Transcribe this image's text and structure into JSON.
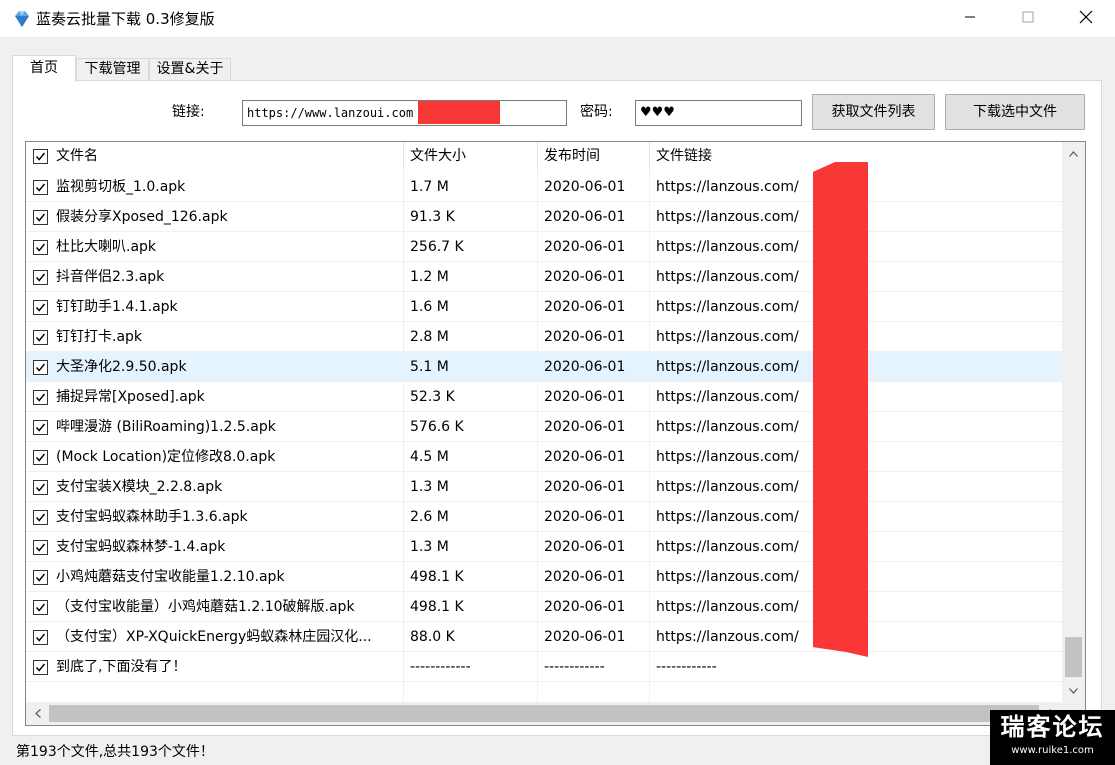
{
  "window": {
    "title": "蓝奏云批量下载 0.3修复版",
    "icon": "diamond-icon",
    "controls": [
      "minimize-icon",
      "maximize-icon",
      "close-icon"
    ]
  },
  "tabs": [
    {
      "label": "首页",
      "active": true
    },
    {
      "label": "下载管理",
      "active": false
    },
    {
      "label": "设置&关于",
      "active": false
    }
  ],
  "form": {
    "link_label": "链接:",
    "link_value": "https://www.lanzoui.com",
    "password_label": "密码:",
    "password_value": "♥♥♥",
    "fetch_button": "获取文件列表",
    "download_button": "下载选中文件"
  },
  "table": {
    "headers": {
      "name": "文件名",
      "size": "文件大小",
      "date": "发布时间",
      "link": "文件链接"
    },
    "rows": [
      {
        "name": "监视剪切板_1.0.apk",
        "size": "1.7 M",
        "date": "2020-06-01",
        "link": "https://lanzous.com/",
        "checked": true
      },
      {
        "name": "假装分享Xposed_126.apk",
        "size": "91.3 K",
        "date": "2020-06-01",
        "link": "https://lanzous.com/",
        "checked": true
      },
      {
        "name": "杜比大喇叭.apk",
        "size": "256.7 K",
        "date": "2020-06-01",
        "link": "https://lanzous.com/",
        "checked": true
      },
      {
        "name": "抖音伴侣2.3.apk",
        "size": "1.2 M",
        "date": "2020-06-01",
        "link": "https://lanzous.com/",
        "checked": true
      },
      {
        "name": "钉钉助手1.4.1.apk",
        "size": "1.6 M",
        "date": "2020-06-01",
        "link": "https://lanzous.com/",
        "checked": true
      },
      {
        "name": "钉钉打卡.apk",
        "size": "2.8 M",
        "date": "2020-06-01",
        "link": "https://lanzous.com/",
        "checked": true
      },
      {
        "name": "大圣净化2.9.50.apk",
        "size": "5.1 M",
        "date": "2020-06-01",
        "link": "https://lanzous.com/",
        "checked": true,
        "selected": true
      },
      {
        "name": "捕捉异常[Xposed].apk",
        "size": "52.3 K",
        "date": "2020-06-01",
        "link": "https://lanzous.com/",
        "checked": true
      },
      {
        "name": "哔哩漫游 (BiliRoaming)1.2.5.apk",
        "size": "576.6 K",
        "date": "2020-06-01",
        "link": "https://lanzous.com/",
        "checked": true
      },
      {
        "name": "(Mock Location)定位修改8.0.apk",
        "size": "4.5 M",
        "date": "2020-06-01",
        "link": "https://lanzous.com/",
        "checked": true
      },
      {
        "name": "支付宝装X模块_2.2.8.apk",
        "size": "1.3 M",
        "date": "2020-06-01",
        "link": "https://lanzous.com/",
        "checked": true
      },
      {
        "name": "支付宝蚂蚁森林助手1.3.6.apk",
        "size": "2.6 M",
        "date": "2020-06-01",
        "link": "https://lanzous.com/",
        "checked": true
      },
      {
        "name": "支付宝蚂蚁森林梦-1.4.apk",
        "size": "1.3 M",
        "date": "2020-06-01",
        "link": "https://lanzous.com/",
        "checked": true
      },
      {
        "name": "小鸡炖蘑菇支付宝收能量1.2.10.apk",
        "size": "498.1 K",
        "date": "2020-06-01",
        "link": "https://lanzous.com/",
        "checked": true
      },
      {
        "name": "（支付宝收能量）小鸡炖蘑菇1.2.10破解版.apk",
        "size": "498.1 K",
        "date": "2020-06-01",
        "link": "https://lanzous.com/",
        "checked": true
      },
      {
        "name": "（支付宝）XP-XQuickEnergy蚂蚁森林庄园汉化...",
        "size": "88.0 K",
        "date": "2020-06-01",
        "link": "https://lanzous.com/",
        "checked": true
      },
      {
        "name": "到底了,下面没有了！",
        "size": "------------",
        "date": "------------",
        "link": "------------",
        "checked": true
      }
    ]
  },
  "status": "第193个文件,总共193个文件！",
  "watermark": {
    "main": "瑞客论坛",
    "url": "www.ruike1.com"
  },
  "colors": {
    "redaction": "#fa3737",
    "selected_row": "#e5f3ff",
    "button_face": "#e1e1e1"
  }
}
